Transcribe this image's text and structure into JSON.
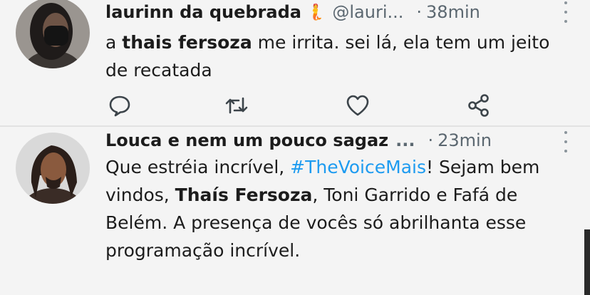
{
  "tweets": [
    {
      "author_name": "laurinn da quebrada",
      "author_emoji": "🧜",
      "author_handle": "@lauri...",
      "separator": "·",
      "timestamp": "38min",
      "text": {
        "p1": "a ",
        "p2_bold": "thais fersoza",
        "p3": " me irrita. sei lá, ela tem um jeito de recatada"
      }
    },
    {
      "author_name": "Louca e nem um pouco sagaz",
      "author_ellipsis": "...",
      "separator": "·",
      "timestamp": "23min",
      "text": {
        "p1": "Que estréia incrível, ",
        "p2_hashtag": "#TheVoiceMais",
        "p3": "! Sejam bem vindos, ",
        "p4_bold": "Thaís Fersoza",
        "p5": ", Toni Garrido e Fafá de Belém. A presença de vocês só abrilhanta esse programação incrível."
      }
    }
  ],
  "icons": {
    "reply": "reply-icon",
    "retweet": "retweet-icon",
    "like": "heart-icon",
    "share": "share-icon",
    "more": "more-options-icon"
  },
  "colors": {
    "background": "#f4f4f4",
    "text": "#1c1c1c",
    "muted": "#5b6770",
    "hashtag": "#1d9bf0"
  }
}
